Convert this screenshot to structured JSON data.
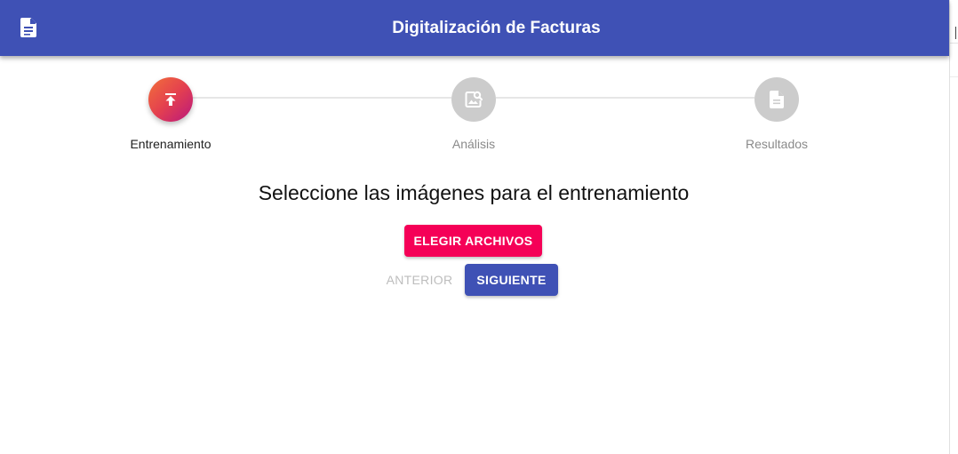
{
  "app": {
    "title": "Digitalización de Facturas",
    "icon": "document-icon",
    "colors": {
      "primary": "#3f51b5",
      "accent": "#f50057",
      "step_inactive": "#cccccc"
    }
  },
  "stepper": {
    "active_index": 0,
    "steps": [
      {
        "label": "Entrenamiento",
        "icon": "upload-icon",
        "state": "active"
      },
      {
        "label": "Análisis",
        "icon": "image-search-icon",
        "state": "inactive"
      },
      {
        "label": "Resultados",
        "icon": "document-icon",
        "state": "inactive"
      }
    ]
  },
  "main": {
    "heading": "Seleccione las imágenes para el entrenamiento",
    "choose_files_label": "ELEGIR ARCHIVOS",
    "prev_label": "ANTERIOR",
    "next_label": "SIGUIENTE"
  }
}
